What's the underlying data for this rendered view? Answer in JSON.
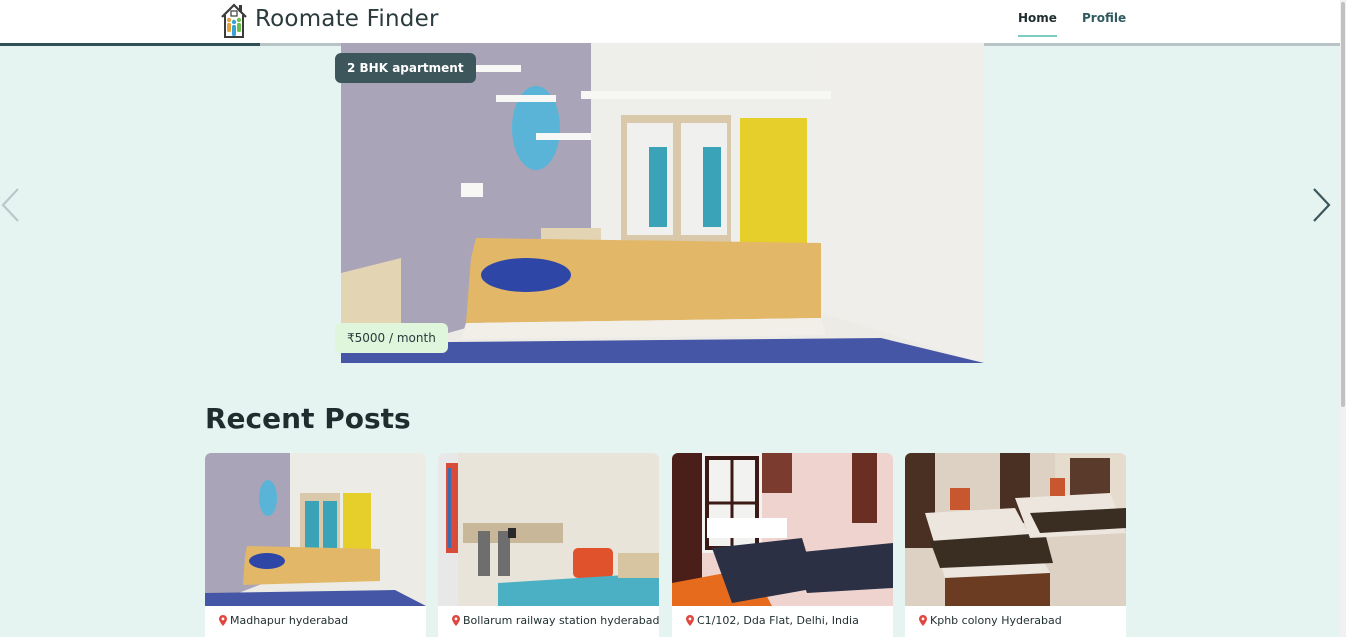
{
  "header": {
    "brand": "Roomate Finder",
    "nav": {
      "home": "Home",
      "profile": "Profile"
    },
    "progress_fraction": 0.194
  },
  "carousel": {
    "title": "2 BHK apartment",
    "price": "₹5000 / month",
    "prev_icon": "chevron-left-icon",
    "next_icon": "chevron-right-icon"
  },
  "recent": {
    "heading": "Recent Posts",
    "cards": [
      {
        "location": "Madhapur hyderabad"
      },
      {
        "location": "Bollarum railway station hyderabad"
      },
      {
        "location": "C1/102, Dda Flat, Delhi, India"
      },
      {
        "location": "Kphb colony Hyderabad"
      }
    ]
  },
  "colors": {
    "page_bg": "#e6f4f1",
    "accent_dark": "#3d565b",
    "accent_light": "#7ecbc3",
    "price_badge": "#dff5dc",
    "pin": "#e0473f"
  }
}
